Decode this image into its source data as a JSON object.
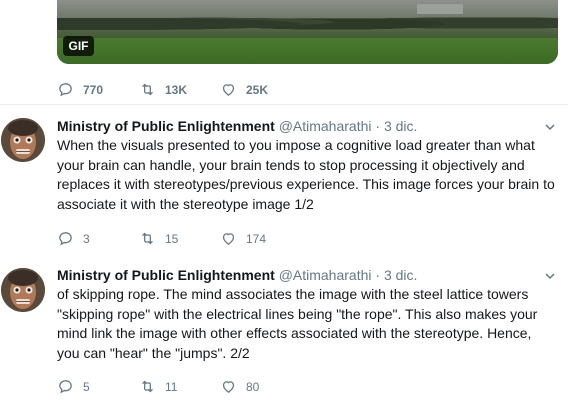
{
  "top": {
    "gif_badge": "GIF",
    "reply_count": "770",
    "retweet_count": "13K",
    "like_count": "25K"
  },
  "tweets": [
    {
      "name": "Ministry of Public Enlightenment",
      "handle": "@Atimaharathi",
      "dot": "·",
      "date": "3 dic.",
      "text": "When the visuals presented to you impose a cognitive load greater than what your brain can handle, your brain tends to stop processing it objectively and replaces it with stereotypes/previous experience. This image forces your brain to associate it with the stereotype image 1/2",
      "reply_count": "3",
      "retweet_count": "15",
      "like_count": "174"
    },
    {
      "name": "Ministry of Public Enlightenment",
      "handle": "@Atimaharathi",
      "dot": "·",
      "date": "3 dic.",
      "text": "of skipping rope. The mind associates the image with the steel lattice towers \"skipping rope\" with the electrical lines being \"the rope\". This also makes your mind link the image with other effects associated with the stereotype. Hence, you can \"hear\" the \"jumps\". 2/2",
      "reply_count": "5",
      "retweet_count": "11",
      "like_count": "80"
    }
  ],
  "colors": {
    "text": "#14171a",
    "secondary": "#657786",
    "divider": "#e6ecf0"
  },
  "icons": [
    "reply-icon",
    "retweet-icon",
    "like-icon",
    "chevron-down-icon"
  ]
}
